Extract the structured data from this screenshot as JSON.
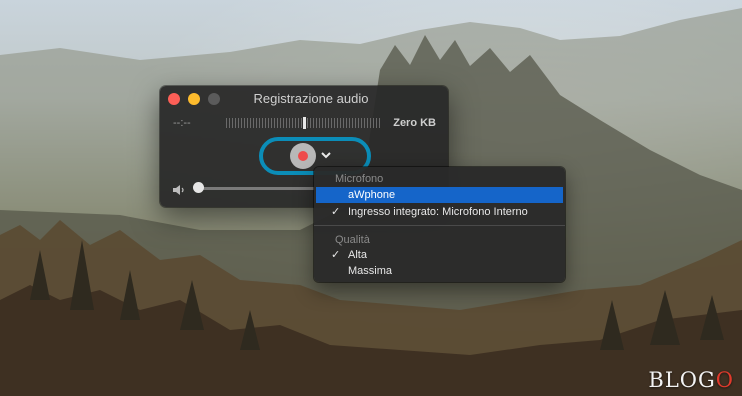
{
  "window": {
    "title": "Registrazione audio",
    "elapsed_time": "--:--",
    "file_size": "Zero KB"
  },
  "icons": {
    "close": "close-button",
    "minimize": "minimize-button",
    "zoom": "zoom-button",
    "record": "record-icon",
    "options": "chevron-down-icon",
    "volume": "speaker-icon"
  },
  "volume": {
    "level": 0.0
  },
  "menu": {
    "microphone_header": "Microfono",
    "microphone_items": [
      {
        "label": "aWphone",
        "checked": false,
        "highlighted": true
      },
      {
        "label": "Ingresso integrato: Microfono Interno",
        "checked": true,
        "highlighted": false
      }
    ],
    "quality_header": "Qualità",
    "quality_items": [
      {
        "label": "Alta",
        "checked": true
      },
      {
        "label": "Massima",
        "checked": false
      }
    ],
    "check_glyph": "✓"
  },
  "watermark": {
    "prefix": "BLOG",
    "suffix": "O"
  },
  "colors": {
    "accent_ring": "#0b8db8",
    "selection": "#1565c9",
    "record_dot": "#ee4b4b"
  }
}
